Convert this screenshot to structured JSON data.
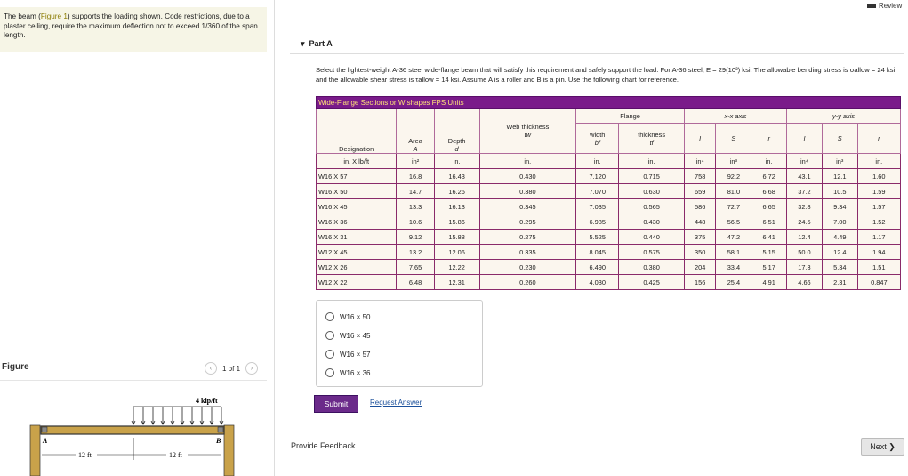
{
  "header": {
    "review": "Review"
  },
  "problem": {
    "pre": "The beam (",
    "figure_link": "Figure 1",
    "post": ") supports the loading shown. Code restrictions, due to a plaster ceiling, require the maximum deflection not to exceed 1/360 of the span length."
  },
  "part": {
    "label": "Part A"
  },
  "question": "Select the lightest-weight A-36 steel wide-flange beam that will satisfy this requirement and safely support the load. For A-36 steel, E = 29(10³) ksi. The allowable bending stress is σallow = 24 ksi and the allowable shear stress is τallow = 14 ksi. Assume A is a roller and B is a pin. Use the following chart for reference.",
  "table": {
    "title": "Wide-Flange Sections or W shapes FPS Units",
    "groups": {
      "web": "Web thickness",
      "web_sym": "tw",
      "flange": "Flange",
      "xx": "x-x axis",
      "yy": "y-y axis"
    },
    "cols": {
      "designation": "Designation",
      "area": "Area",
      "area_sym": "A",
      "depth": "Depth",
      "depth_sym": "d",
      "width": "width",
      "width_sym": "bf",
      "thick": "thickness",
      "thick_sym": "tf",
      "I": "I",
      "S": "S",
      "r": "r"
    },
    "units": [
      "in. X lb/ft",
      "in²",
      "in.",
      "in.",
      "in.",
      "in.",
      "in⁴",
      "in³",
      "in.",
      "in⁴",
      "in³",
      "in."
    ],
    "rows": [
      [
        "W16 X 57",
        "16.8",
        "16.43",
        "0.430",
        "7.120",
        "0.715",
        "758",
        "92.2",
        "6.72",
        "43.1",
        "12.1",
        "1.60"
      ],
      [
        "W16 X 50",
        "14.7",
        "16.26",
        "0.380",
        "7.070",
        "0.630",
        "659",
        "81.0",
        "6.68",
        "37.2",
        "10.5",
        "1.59"
      ],
      [
        "W16 X 45",
        "13.3",
        "16.13",
        "0.345",
        "7.035",
        "0.565",
        "586",
        "72.7",
        "6.65",
        "32.8",
        "9.34",
        "1.57"
      ],
      [
        "W16 X 36",
        "10.6",
        "15.86",
        "0.295",
        "6.985",
        "0.430",
        "448",
        "56.5",
        "6.51",
        "24.5",
        "7.00",
        "1.52"
      ],
      [
        "W16 X 31",
        "9.12",
        "15.88",
        "0.275",
        "5.525",
        "0.440",
        "375",
        "47.2",
        "6.41",
        "12.4",
        "4.49",
        "1.17"
      ],
      [
        "W12 X 45",
        "13.2",
        "12.06",
        "0.335",
        "8.045",
        "0.575",
        "350",
        "58.1",
        "5.15",
        "50.0",
        "12.4",
        "1.94"
      ],
      [
        "W12 X 26",
        "7.65",
        "12.22",
        "0.230",
        "6.490",
        "0.380",
        "204",
        "33.4",
        "5.17",
        "17.3",
        "5.34",
        "1.51"
      ],
      [
        "W12 X 22",
        "6.48",
        "12.31",
        "0.260",
        "4.030",
        "0.425",
        "156",
        "25.4",
        "4.91",
        "4.66",
        "2.31",
        "0.847"
      ]
    ]
  },
  "options": [
    "W16 × 50",
    "W16 × 45",
    "W16 × 57",
    "W16 × 36"
  ],
  "buttons": {
    "submit": "Submit",
    "request": "Request Answer",
    "feedback": "Provide Feedback",
    "next": "Next ❯"
  },
  "figure": {
    "label": "Figure",
    "page": "1 of 1",
    "load": "4 kip/ft",
    "span1": "12 ft",
    "span2": "12 ft",
    "a": "A",
    "b": "B"
  },
  "colors": {
    "accent": "#7a1b8a",
    "beam": "#c9a24a"
  }
}
